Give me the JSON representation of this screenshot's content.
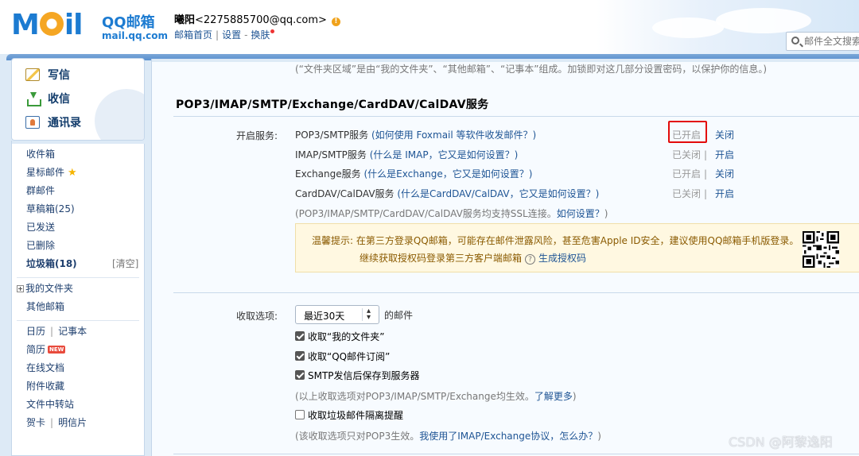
{
  "header": {
    "logo_text": "MOil",
    "brand": "QQ邮箱",
    "domain": "mail.qq.com",
    "user_name": "曦阳",
    "user_email": "<2275885700@qq.com>",
    "warning_icon": "warning-icon",
    "links": [
      "邮箱首页",
      "设置",
      "换肤"
    ],
    "search_placeholder": "邮件全文搜索"
  },
  "sidebar": {
    "commands": [
      {
        "label": "写信",
        "icon": "compose-icon"
      },
      {
        "label": "收信",
        "icon": "inbox-download-icon"
      },
      {
        "label": "通讯录",
        "icon": "contacts-icon"
      }
    ],
    "folders": [
      {
        "label": "收件箱"
      },
      {
        "label": "星标邮件",
        "icon": "star-icon"
      },
      {
        "label": "群邮件"
      },
      {
        "label": "草稿箱(25)"
      },
      {
        "label": "已发送"
      },
      {
        "label": "已删除"
      },
      {
        "label": "垃圾箱(18)",
        "action": "[清空]"
      }
    ],
    "my_folders": "我的文件夹",
    "other_mail": "其他邮箱",
    "apps": {
      "calendar": "日历",
      "notes": "记事本",
      "resume": "简历",
      "new_badge": "NEW",
      "docs": "在线文档",
      "attachments": "附件收藏",
      "transfer": "文件中转站",
      "greeting": "贺卡",
      "postcard": "明信片"
    }
  },
  "main": {
    "top_note": "(“文件夹区域”是由“我的文件夹”、“其他邮箱”、“记事本”组成。加锁即对这几部分设置密码，以保护你的信息。)",
    "section_title": "POP3/IMAP/SMTP/Exchange/CardDAV/CalDAV服务",
    "enable_label": "开启服务:",
    "services": [
      {
        "name": "POP3/SMTP服务",
        "help": "(如何使用 Foxmail 等软件收发邮件？)",
        "state": "已开启",
        "action": "关闭"
      },
      {
        "name": "IMAP/SMTP服务",
        "help": "(什么是 IMAP，它又是如何设置？)",
        "state": "已关闭",
        "action": "开启"
      },
      {
        "name": "Exchange服务",
        "help": "(什么是Exchange，它又是如何设置？)",
        "state": "已开启",
        "action": "关闭"
      },
      {
        "name": "CardDAV/CalDAV服务",
        "help": "(什么是CardDAV/CalDAV，它又是如何设置？)",
        "state": "已关闭",
        "action": "开启"
      }
    ],
    "ssl_note": "(POP3/IMAP/SMTP/CardDAV/CalDAV服务均支持SSL连接。",
    "ssl_link": "如何设置？",
    "ssl_tail": ")",
    "tip_line1": "温馨提示: 在第三方登录QQ邮箱，可能存在邮件泄露风险，甚至危害Apple ID安全，建议使用QQ邮箱手机版登录。",
    "tip_line2": "继续获取授权码登录第三方客户端邮箱",
    "tip_help": "?",
    "tip_link": "生成授权码",
    "qr_icon": "qr-code-icon",
    "receive_label": "收取选项:",
    "receive_select": "最近30天",
    "receive_suffix": "的邮件",
    "options": [
      {
        "label": "收取“我的文件夹”",
        "checked": true
      },
      {
        "label": "收取“QQ邮件订阅”",
        "checked": true
      },
      {
        "label": "SMTP发信后保存到服务器",
        "checked": true
      }
    ],
    "options_note": "(以上收取选项对POP3/IMAP/SMTP/Exchange均生效。",
    "options_link": "了解更多",
    "options_tail": ")",
    "junk_option": "收取垃圾邮件隔离提醒",
    "junk_checked": false,
    "junk_note": "(该收取选项只对POP3生效。",
    "junk_link": "我使用了IMAP/Exchange协议，怎么办？",
    "junk_tail": ")"
  },
  "watermark": "CSDN @阿黎逸阳",
  "colors": {
    "brand_blue": "#1c7bd1",
    "link": "#1e5494",
    "highlight": "#e30b0b",
    "tip_bg": "#fff8e1"
  }
}
